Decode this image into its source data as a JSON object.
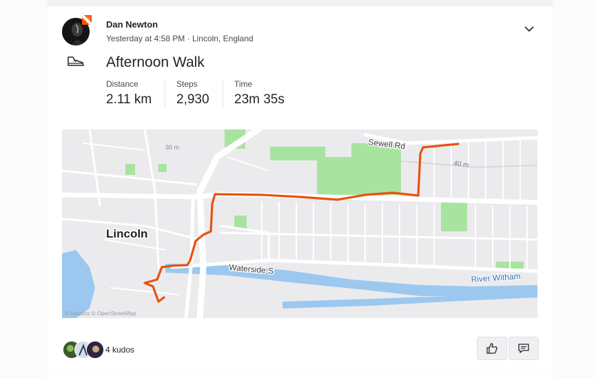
{
  "activity": {
    "athlete_name": "Dan Newton",
    "meta": "Yesterday at 4:58 PM · Lincoln, England",
    "type_icon": "shoe-icon",
    "title": "Afternoon Walk",
    "stats": [
      {
        "label": "Distance",
        "value": "2.11 km"
      },
      {
        "label": "Steps",
        "value": "2,930"
      },
      {
        "label": "Time",
        "value": "23m 35s"
      }
    ]
  },
  "map": {
    "labels": {
      "city": "Lincoln",
      "street_sewell": "Sewell Rd",
      "street_waterside": "Waterside S",
      "river": "River Witham",
      "contour": "40 m",
      "contour_small": "30 m",
      "attribution": "© Mapbox © OpenStreetMap"
    },
    "colors": {
      "route": "#e8520c",
      "land": "#ebebee",
      "park": "#a9e3a0",
      "water": "#9cc8f0",
      "road": "#ffffff"
    }
  },
  "social": {
    "kudos_label": "4 kudos",
    "kudos_icon": "thumbs-up-icon",
    "comment_icon": "comment-icon"
  }
}
